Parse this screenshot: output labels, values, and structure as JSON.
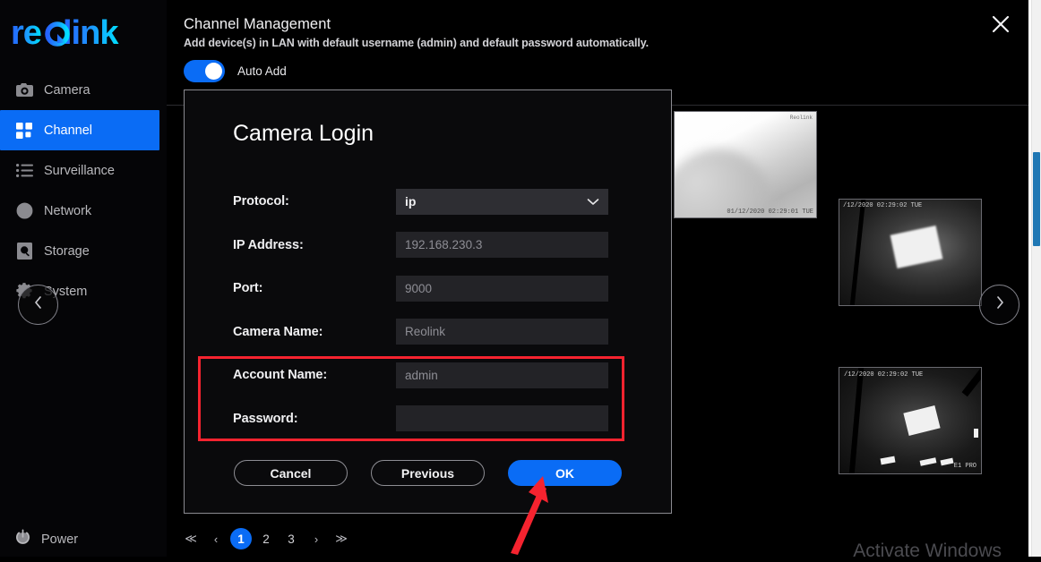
{
  "sidebar": {
    "logo_text": "reolink",
    "items": [
      {
        "label": "Camera",
        "icon": "camera-icon",
        "active": false
      },
      {
        "label": "Channel",
        "icon": "grid-icon",
        "active": true
      },
      {
        "label": "Surveillance",
        "icon": "list-icon",
        "active": false
      },
      {
        "label": "Network",
        "icon": "globe-icon",
        "active": false
      },
      {
        "label": "Storage",
        "icon": "disk-search-icon",
        "active": false
      },
      {
        "label": "System",
        "icon": "gear-icon",
        "active": false
      }
    ],
    "power_label": "Power",
    "collapse_icon": "chevron-left-icon"
  },
  "header": {
    "title": "Channel Management",
    "subtitle": "Add device(s) in LAN with default username (admin) and default password automatically.",
    "close_icon": "close-icon"
  },
  "auto_add": {
    "label": "Auto Add",
    "enabled": true
  },
  "thumbnails": [
    {
      "name": "camera-thumb-1",
      "timestamp": "01/12/2020 02:29:01 TUE",
      "corner_label": "Reolink"
    },
    {
      "name": "camera-thumb-2",
      "timestamp": "/12/2020 02:29:02 TUE",
      "corner_label": ""
    },
    {
      "name": "camera-thumb-3",
      "timestamp": "/12/2020 02:29:02 TUE",
      "corner_label": "E1 PRO"
    }
  ],
  "next_page_icon": "chevron-right-icon",
  "pagination": {
    "first_icon": "≪",
    "prev_icon": "‹",
    "next_icon": "›",
    "last_icon": "≫",
    "pages": [
      "1",
      "2",
      "3"
    ],
    "current": "1"
  },
  "dialog": {
    "title": "Camera Login",
    "fields": [
      {
        "label": "Protocol:",
        "value": "ip",
        "type": "select",
        "name": "protocol-select"
      },
      {
        "label": "IP Address:",
        "value": "192.168.230.3",
        "type": "input",
        "name": "ip-address-field"
      },
      {
        "label": "Port:",
        "value": "9000",
        "type": "input",
        "name": "port-field"
      },
      {
        "label": "Camera Name:",
        "value": "Reolink",
        "type": "input",
        "name": "camera-name-field"
      },
      {
        "label": "Account Name:",
        "value": "admin",
        "type": "input",
        "name": "account-name-field"
      },
      {
        "label": "Password:",
        "value": "",
        "type": "password",
        "name": "password-field"
      }
    ],
    "buttons": {
      "cancel": "Cancel",
      "previous": "Previous",
      "ok": "OK"
    }
  },
  "watermark": "Activate Windows",
  "colors": {
    "accent": "#0a6cf5",
    "annotation": "#f5232f",
    "panel": "#0a0a0c",
    "field": "#232327"
  }
}
